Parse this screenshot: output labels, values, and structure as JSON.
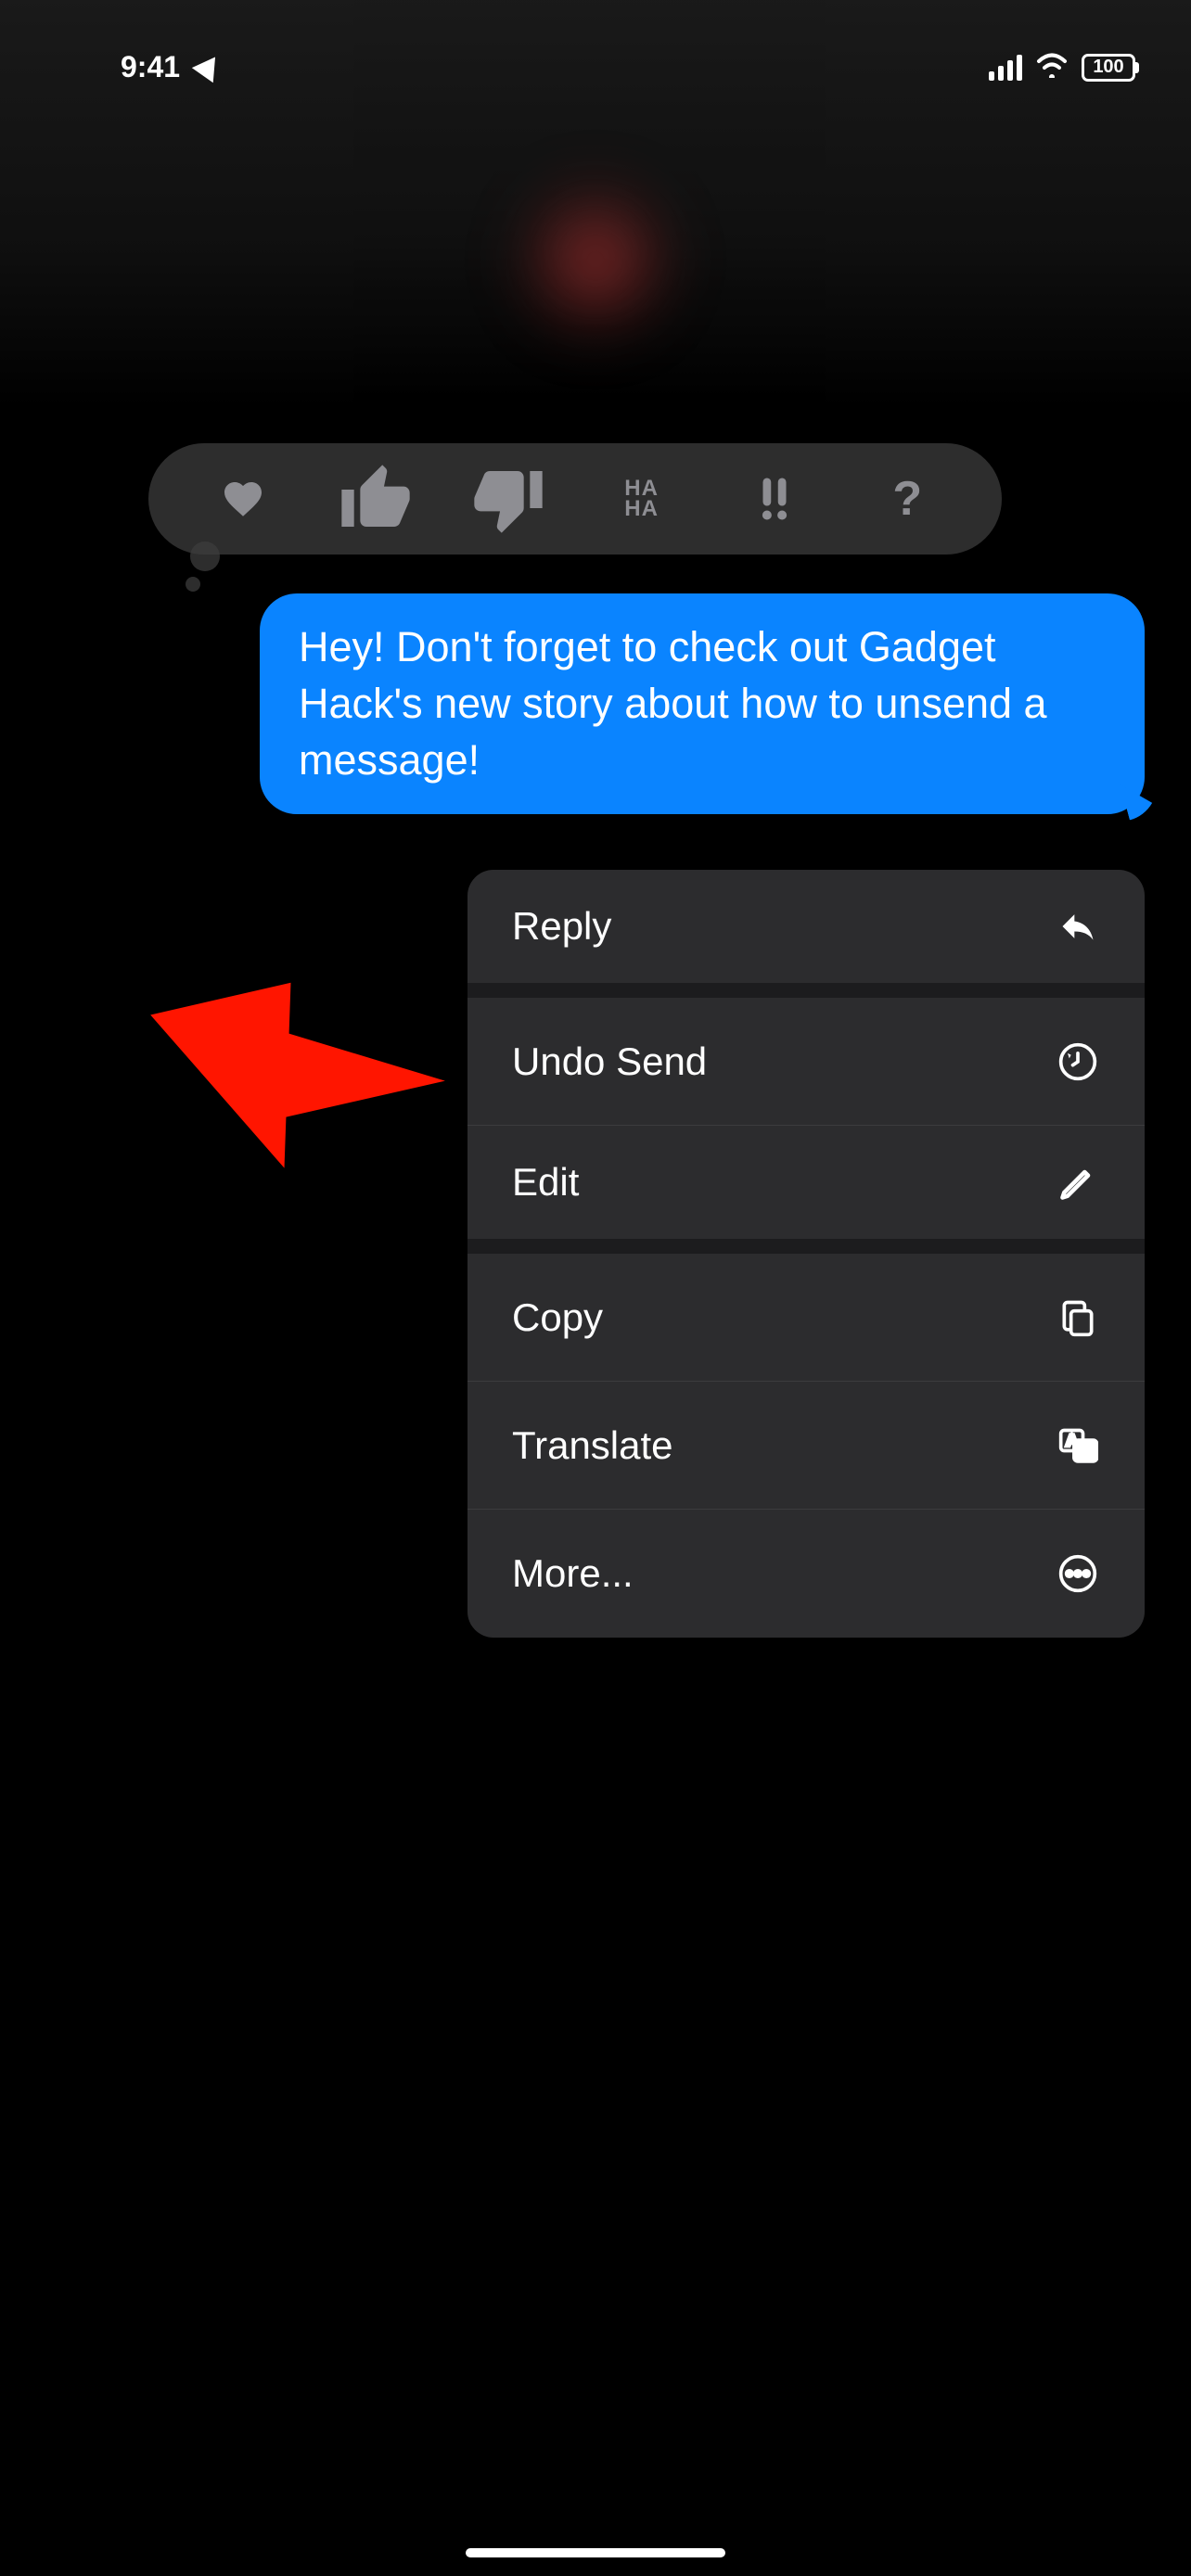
{
  "status_bar": {
    "time": "9:41",
    "battery": "100"
  },
  "tapback": {
    "haha_label": "HA\nHA"
  },
  "message": {
    "text": "Hey! Don't forget to check out Gadget Hack's new story about how to unsend a message!"
  },
  "context_menu": {
    "items": [
      {
        "label": "Reply",
        "icon": "reply"
      },
      {
        "label": "Undo Send",
        "icon": "undo"
      },
      {
        "label": "Edit",
        "icon": "edit"
      },
      {
        "label": "Copy",
        "icon": "copy"
      },
      {
        "label": "Translate",
        "icon": "translate"
      },
      {
        "label": "More...",
        "icon": "more"
      }
    ]
  }
}
